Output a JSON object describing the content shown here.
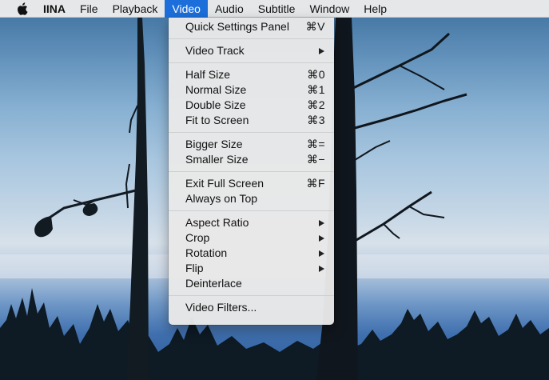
{
  "menubar": {
    "app_name": "IINA",
    "items": [
      "File",
      "Playback",
      "Video",
      "Audio",
      "Subtitle",
      "Window",
      "Help"
    ],
    "active": "Video"
  },
  "video_menu": {
    "groups": [
      [
        {
          "label": "Quick Settings Panel",
          "shortcut": "⌘V"
        }
      ],
      [
        {
          "label": "Video Track",
          "submenu": true
        }
      ],
      [
        {
          "label": "Half Size",
          "shortcut": "⌘0"
        },
        {
          "label": "Normal Size",
          "shortcut": "⌘1"
        },
        {
          "label": "Double Size",
          "shortcut": "⌘2"
        },
        {
          "label": "Fit to Screen",
          "shortcut": "⌘3"
        }
      ],
      [
        {
          "label": "Bigger Size",
          "shortcut": "⌘="
        },
        {
          "label": "Smaller Size",
          "shortcut": "⌘−"
        }
      ],
      [
        {
          "label": "Exit Full Screen",
          "shortcut": "⌘F"
        },
        {
          "label": "Always on Top"
        }
      ],
      [
        {
          "label": "Aspect Ratio",
          "submenu": true
        },
        {
          "label": "Crop",
          "submenu": true
        },
        {
          "label": "Rotation",
          "submenu": true
        },
        {
          "label": "Flip",
          "submenu": true
        },
        {
          "label": "Deinterlace"
        }
      ],
      [
        {
          "label": "Video Filters..."
        }
      ]
    ]
  },
  "icons": {
    "apple": "apple-logo-icon",
    "submenu": "submenu-arrow-icon"
  },
  "colors": {
    "menu_highlight": "#1c6fdb",
    "menubar_bg": "#ececec",
    "menu_bg": "#e8e8e8"
  }
}
